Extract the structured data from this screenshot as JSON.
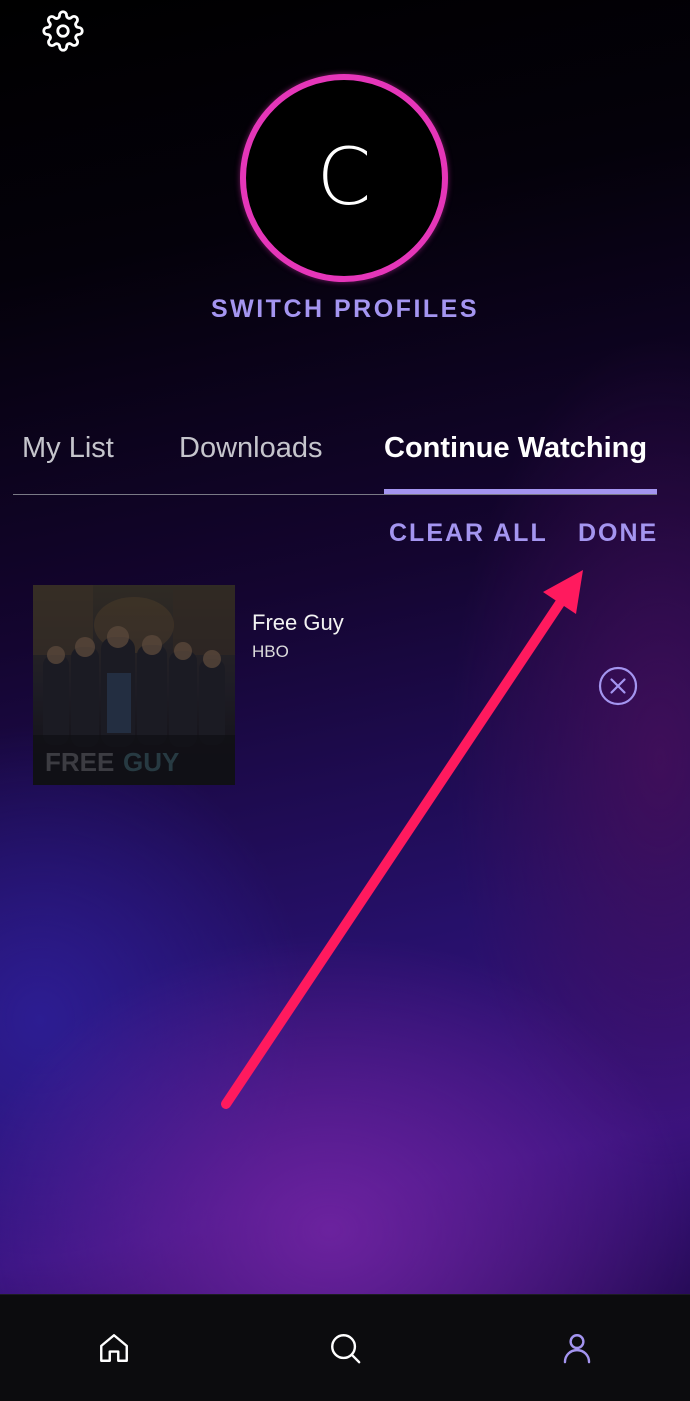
{
  "header": {
    "settings_icon": "gear-icon"
  },
  "profile": {
    "initial": "C",
    "switch_label": "SWITCH PROFILES",
    "ring_color": "#e536b9"
  },
  "tabs": [
    {
      "label": "My List",
      "active": false
    },
    {
      "label": "Downloads",
      "active": false
    },
    {
      "label": "Continue Watching",
      "active": true
    }
  ],
  "actions": {
    "clear_all": "CLEAR ALL",
    "done": "DONE"
  },
  "items": [
    {
      "title": "Free Guy",
      "network": "HBO",
      "thumbnail_text": "FREE GUY",
      "remove_icon": "close-circle-icon"
    }
  ],
  "bottom_nav": [
    {
      "icon": "home-icon",
      "active": false
    },
    {
      "icon": "search-icon",
      "active": false
    },
    {
      "icon": "profile-icon",
      "active": true
    }
  ],
  "colors": {
    "accent": "#a495f0",
    "annotation_arrow": "#ff1a5e",
    "nav_bg": "#0c0c0e"
  }
}
